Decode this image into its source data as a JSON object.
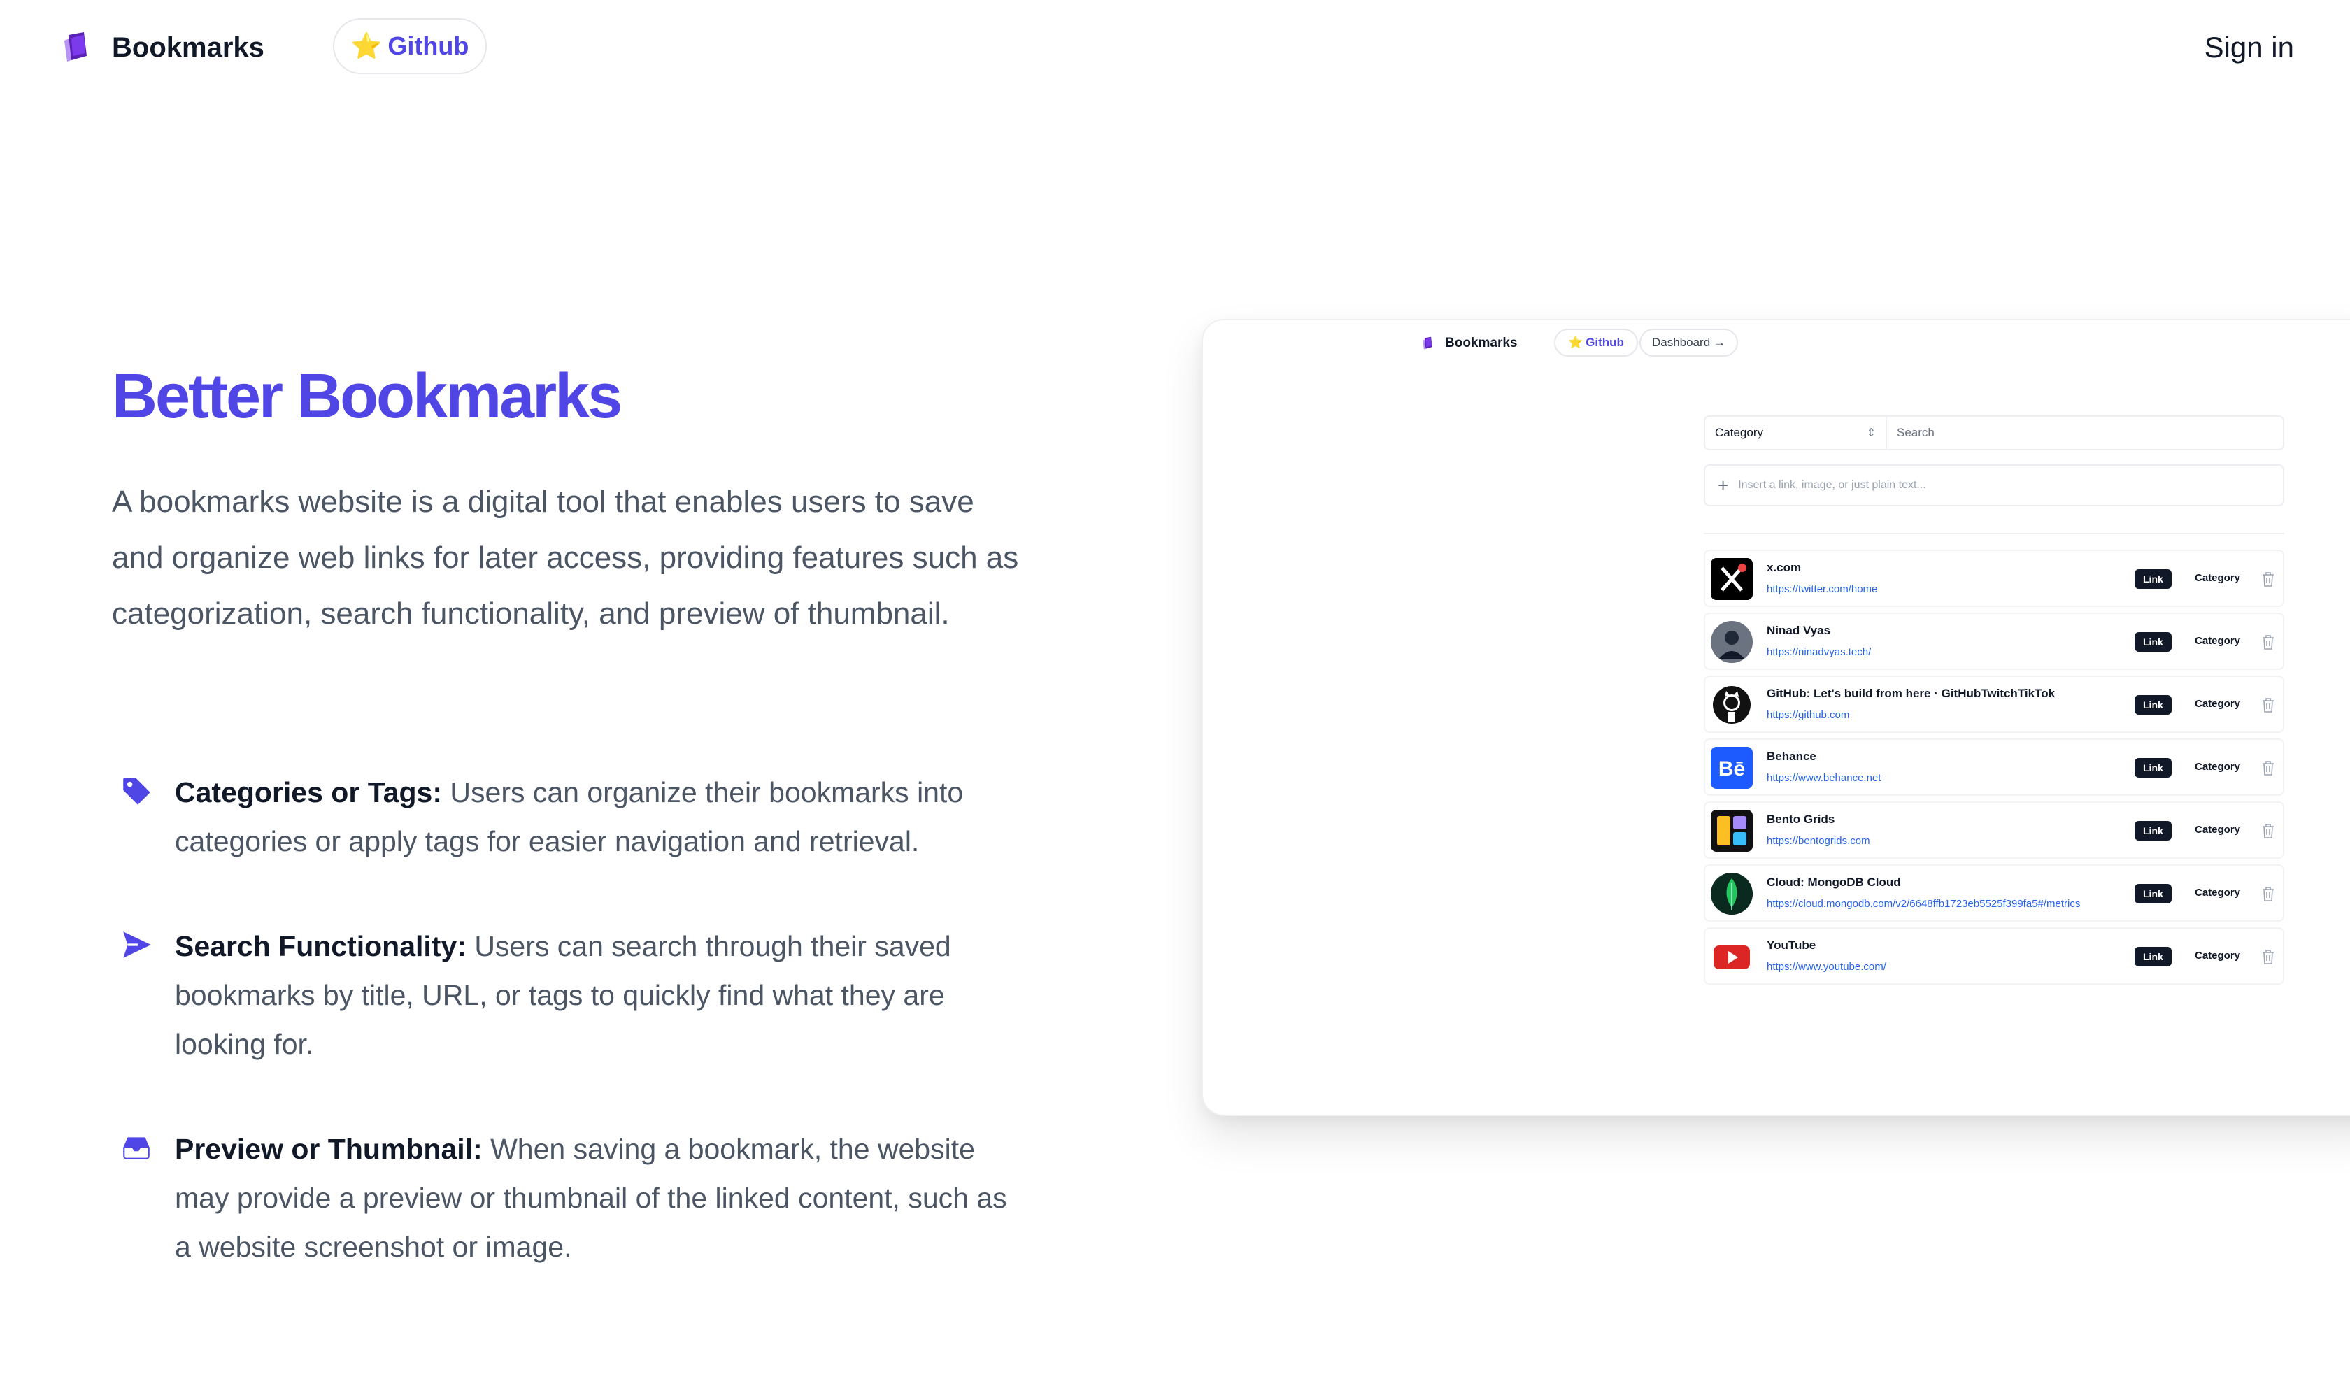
{
  "nav": {
    "brand": "Bookmarks",
    "github_label": "Github",
    "sign_in": "Sign in"
  },
  "hero": {
    "title": "Better Bookmarks",
    "description": "A bookmarks website is a digital tool that enables users to save and organize web links for later access, providing features such as categorization, search functionality, and preview of thumbnail."
  },
  "features": [
    {
      "icon": "tag-icon",
      "title": "Categories or Tags:",
      "text": "Users can organize their bookmarks into categories or apply tags for easier navigation and retrieval."
    },
    {
      "icon": "paper-plane-icon",
      "title": "Search Functionality:",
      "text": "Users can search through their saved bookmarks by title, URL, or tags to quickly find what they are looking for."
    },
    {
      "icon": "inbox-icon",
      "title": "Preview or Thumbnail:",
      "text": "When saving a bookmark, the website may provide a preview or thumbnail of the linked content, such as a website screenshot or image."
    }
  ],
  "preview": {
    "brand": "Bookmarks",
    "github_label": "Github",
    "dashboard_label": "Dashboard →",
    "category_select": "Category",
    "search_placeholder": "Search",
    "insert_placeholder": "Insert a link, image, or just plain text...",
    "bookmarks": [
      {
        "title": "x.com",
        "url": "https://twitter.com/home",
        "badge": "Link",
        "category": "Category",
        "icon": "x-logo-icon"
      },
      {
        "title": "Ninad Vyas",
        "url": "https://ninadvyas.tech/",
        "badge": "Link",
        "category": "Category",
        "icon": "avatar-icon"
      },
      {
        "title": "GitHub: Let's build from here · GitHubTwitchTikTok",
        "url": "https://github.com",
        "badge": "Link",
        "category": "Category",
        "icon": "github-icon"
      },
      {
        "title": "Behance",
        "url": "https://www.behance.net",
        "badge": "Link",
        "category": "Category",
        "icon": "behance-icon"
      },
      {
        "title": "Bento Grids",
        "url": "https://bentogrids.com",
        "badge": "Link",
        "category": "Category",
        "icon": "bento-grids-icon"
      },
      {
        "title": "Cloud: MongoDB Cloud",
        "url": "https://cloud.mongodb.com/v2/6648ffb1723eb5525f399fa5#/metrics",
        "badge": "Link",
        "category": "Category",
        "icon": "mongodb-icon"
      },
      {
        "title": "YouTube",
        "url": "https://www.youtube.com/",
        "badge": "Link",
        "category": "Category",
        "icon": "youtube-icon"
      }
    ]
  },
  "colors": {
    "accent": "#4f46e5",
    "text": "#111827",
    "muted": "#4b5563",
    "link": "#2563eb"
  }
}
